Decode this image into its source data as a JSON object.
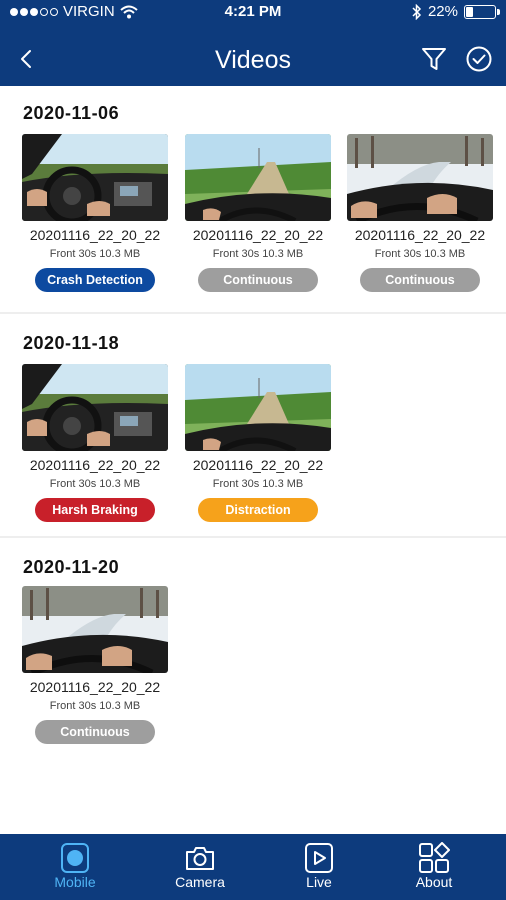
{
  "status_bar": {
    "carrier": "VIRGIN",
    "time": "4:21 PM",
    "battery_percent": "22%",
    "battery_level": 0.22,
    "signal_bars_filled": 3,
    "signal_bars_total": 5
  },
  "header": {
    "title": "Videos",
    "back_icon": "chevron-left-icon",
    "filter_icon": "filter-icon",
    "select_icon": "check-circle-icon"
  },
  "colors": {
    "brand": "#0d3b7d",
    "crash_detection": "#0d4aa0",
    "continuous": "#9e9e9e",
    "harsh_braking": "#c8202a",
    "distraction": "#f6a21b",
    "active_tab": "#4fb4f5"
  },
  "sections": [
    {
      "date": "2020-11-06",
      "videos": [
        {
          "thumbnail": "driver-interior",
          "name": "20201116_22_20_22",
          "meta": "Front 30s 10.3 MB",
          "tag": "Crash Detection",
          "tag_color": "#0d4aa0"
        },
        {
          "thumbnail": "country-road",
          "name": "20201116_22_20_22",
          "meta": "Front 30s 10.3 MB",
          "tag": "Continuous",
          "tag_color": "#9e9e9e"
        },
        {
          "thumbnail": "snowy-road",
          "name": "20201116_22_20_22",
          "meta": "Front 30s 10.3 MB",
          "tag": "Continuous",
          "tag_color": "#9e9e9e"
        }
      ]
    },
    {
      "date": "2020-11-18",
      "videos": [
        {
          "thumbnail": "driver-interior",
          "name": "20201116_22_20_22",
          "meta": "Front 30s 10.3 MB",
          "tag": "Harsh Braking",
          "tag_color": "#c8202a"
        },
        {
          "thumbnail": "country-road",
          "name": "20201116_22_20_22",
          "meta": "Front 30s 10.3 MB",
          "tag": "Distraction",
          "tag_color": "#f6a21b"
        }
      ]
    },
    {
      "date": "2020-11-20",
      "videos": [
        {
          "thumbnail": "snowy-road",
          "name": "20201116_22_20_22",
          "meta": "Front 30s 10.3 MB",
          "tag": "Continuous",
          "tag_color": "#9e9e9e"
        }
      ]
    }
  ],
  "tab_bar": {
    "active": "Mobile",
    "tabs": [
      {
        "label": "Mobile",
        "icon": "phone-icon"
      },
      {
        "label": "Camera",
        "icon": "camera-icon"
      },
      {
        "label": "Live",
        "icon": "play-icon"
      },
      {
        "label": "About",
        "icon": "grid-icon"
      }
    ]
  }
}
